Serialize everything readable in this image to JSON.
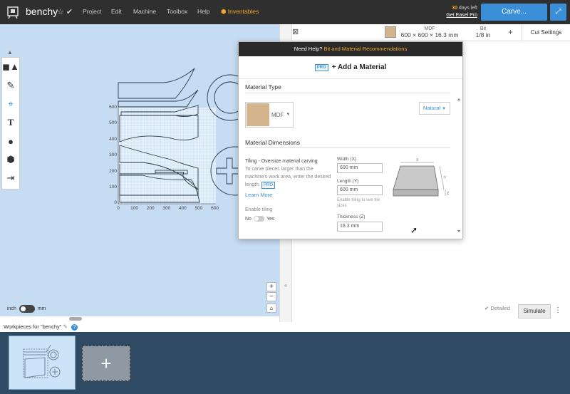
{
  "topbar": {
    "title": "benchy",
    "title_icons": "☆ ✔",
    "menu": [
      "Project",
      "Edit",
      "Machine",
      "Toolbox",
      "Help"
    ],
    "inventables": "Inventables",
    "trial_days": "30",
    "trial_text": " days left",
    "trial_link": "Get Easel Pro",
    "carve_label": "Carve...",
    "expand_icon": "⤢"
  },
  "canvas": {
    "x_ticks": [
      "0",
      "100",
      "200",
      "300",
      "400",
      "500",
      "600"
    ],
    "y_ticks": [
      "600",
      "500",
      "400",
      "300",
      "200",
      "100",
      "0"
    ],
    "unit_left": "inch",
    "unit_right": "mm",
    "zoom_in": "+",
    "zoom_out": "−",
    "home": "⌂",
    "tool_collapse": "▲"
  },
  "material_bar": {
    "material_name": "MDF",
    "material_dims": "600 × 600 × 16.3 mm",
    "bit_label": "Bit",
    "bit_size": "1/8 in",
    "plus": "+",
    "cut_settings": "Cut Settings",
    "icon": "⊠",
    "swatch_color": "#d3b48c"
  },
  "dialog": {
    "help_prefix": "Need Help? ",
    "help_link": "Bit and Material Recommendations",
    "pro_badge": "PRO",
    "title": "+ Add a Material",
    "material_type_label": "Material Type",
    "material_name": "MDF",
    "finish": "Natural",
    "dimensions_label": "Material Dimensions",
    "tiling_title": "Tiling - Oversize material carving",
    "tiling_desc": "To carve pieces larger than the machine's work area, enter the desired length.",
    "tiling_pro": "PRO",
    "learn_more": "Learn More",
    "enable_tiling": "Enable tiling",
    "no_label": "No",
    "yes_label": "Yes",
    "width_label": "Width (X)",
    "width_value": "600 mm",
    "length_label": "Length (Y)",
    "length_value": "600 mm",
    "tile_hint": "Enable tiling to see tile sizes",
    "thickness_label": "Thickness (Z)",
    "thickness_value": "16.3 mm",
    "diagram_x": "X",
    "diagram_y": "Y",
    "diagram_z": "Z"
  },
  "simulate": {
    "detailed": "✔ Detailed",
    "button": "Simulate",
    "more": "⋮"
  },
  "workpieces": {
    "header": "Workpieces for \"benchy\"",
    "edit_icon": "✎",
    "help_icon": "?",
    "add_icon": "+"
  },
  "colors": {
    "accent": "#3b8fd9",
    "orange": "#f0a72d",
    "canvas_bg": "#c6dcf2",
    "mdf": "#d3b48c"
  }
}
